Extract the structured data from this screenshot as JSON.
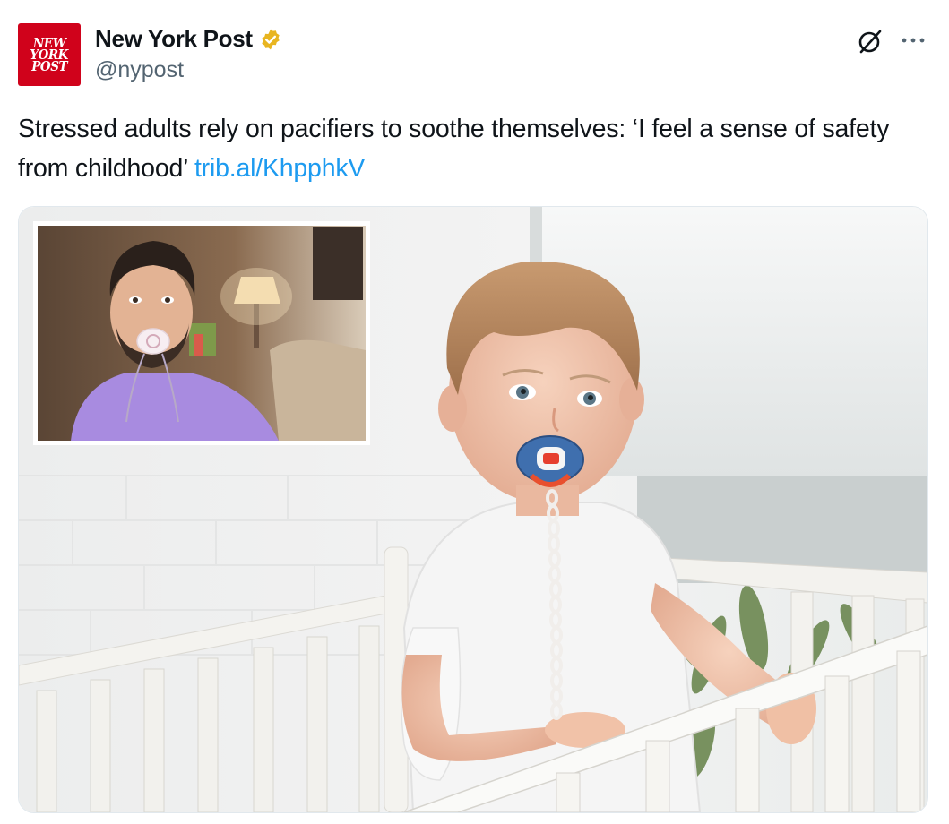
{
  "account": {
    "name": "New York Post",
    "handle": "@nypost",
    "avatar_lines": [
      "NEW",
      "YORK",
      "POST"
    ],
    "verified_color": "#e8b520"
  },
  "tweet": {
    "text": "Stressed adults rely on pacifiers to soothe themselves: ‘I feel a sense of safety from childhood’ ",
    "link": "trib.al/KhpphkV",
    "link_color": "#1d9bf0"
  },
  "media": {
    "inset_subject": "man-with-pacifier",
    "main_subject": "toddler-with-pacifier-in-crib"
  },
  "icons": {
    "grok": "grok-icon",
    "more": "more-icon",
    "verified": "verified-badge-icon"
  },
  "colors": {
    "brand_red": "#d0021b",
    "text": "#0f1419",
    "secondary": "#536471"
  }
}
